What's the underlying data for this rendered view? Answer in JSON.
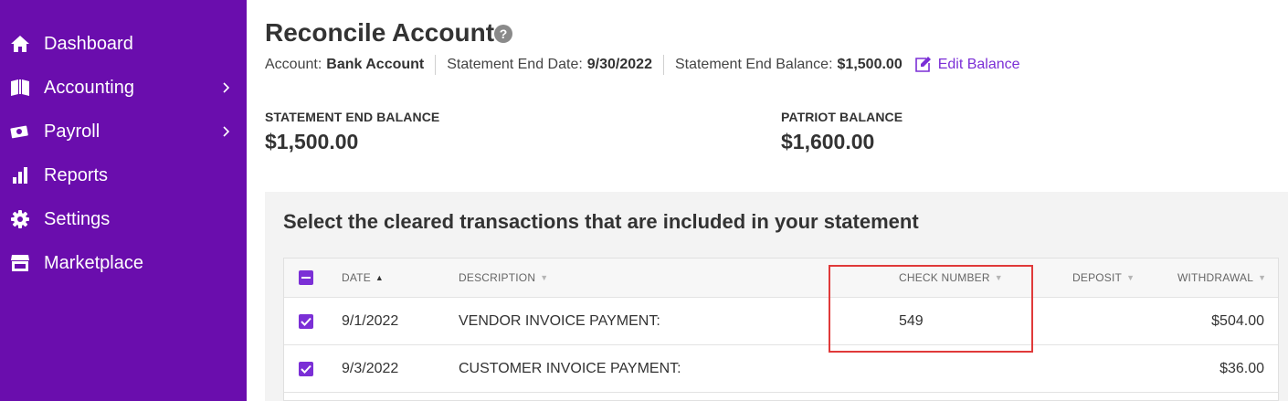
{
  "sidebar": {
    "items": [
      {
        "label": "Dashboard",
        "icon": "home-icon"
      },
      {
        "label": "Accounting",
        "icon": "book-icon",
        "has_submenu": true
      },
      {
        "label": "Payroll",
        "icon": "money-icon",
        "has_submenu": true
      },
      {
        "label": "Reports",
        "icon": "bar-chart-icon"
      },
      {
        "label": "Settings",
        "icon": "gear-icon"
      },
      {
        "label": "Marketplace",
        "icon": "store-icon"
      }
    ]
  },
  "header": {
    "title": "Reconcile Account",
    "help": "?",
    "account_label": "Account:",
    "account_value": "Bank Account",
    "end_date_label": "Statement End Date:",
    "end_date_value": "9/30/2022",
    "end_balance_label": "Statement End Balance:",
    "end_balance_value": "$1,500.00",
    "edit_balance": "Edit Balance"
  },
  "balances": {
    "statement_label": "STATEMENT END BALANCE",
    "statement_value": "$1,500.00",
    "patriot_label": "PATRIOT BALANCE",
    "patriot_value": "$1,600.00"
  },
  "transactions": {
    "title": "Select the cleared transactions that are included in your statement",
    "columns": {
      "date": "DATE",
      "description": "DESCRIPTION",
      "check_number": "CHECK NUMBER",
      "deposit": "DEPOSIT",
      "withdrawal": "WITHDRAWAL"
    },
    "rows": [
      {
        "date": "9/1/2022",
        "description": "VENDOR INVOICE PAYMENT:",
        "check_number": "549",
        "deposit": "",
        "withdrawal": "$504.00",
        "checked": true
      },
      {
        "date": "9/3/2022",
        "description": "CUSTOMER INVOICE PAYMENT:",
        "check_number": "",
        "deposit": "",
        "withdrawal": "$36.00",
        "checked": true
      }
    ]
  },
  "colors": {
    "sidebar": "#6a0dad",
    "accent": "#7b2fd6",
    "highlight": "#e03a3a"
  }
}
